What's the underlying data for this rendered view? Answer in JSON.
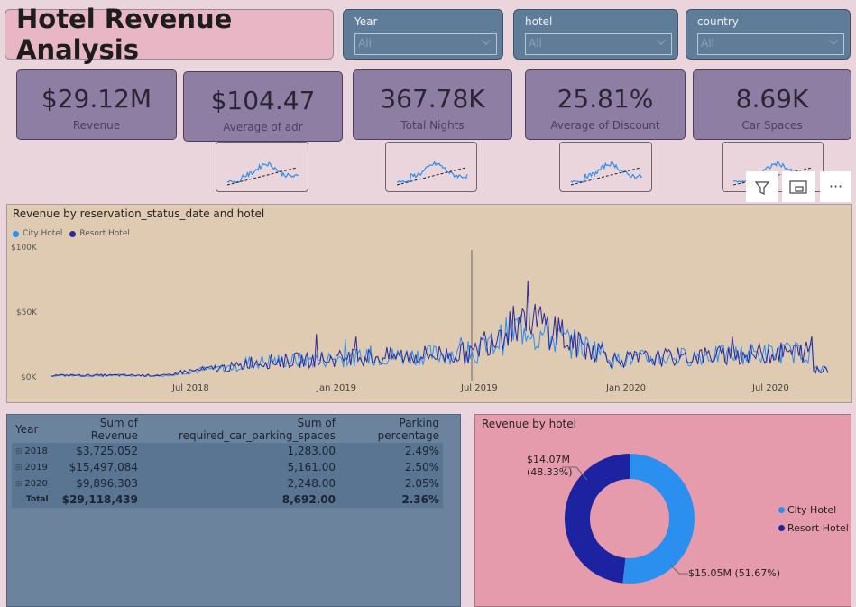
{
  "title": "Hotel Revenue Analysis",
  "slicers": [
    {
      "label": "Year",
      "value": "All"
    },
    {
      "label": "hotel",
      "value": "All"
    },
    {
      "label": "country",
      "value": "All"
    }
  ],
  "kpis": [
    {
      "value": "$29.12M",
      "caption": "Revenue"
    },
    {
      "value": "$104.47",
      "caption": "Average of adr"
    },
    {
      "value": "367.78K",
      "caption": "Total Nights"
    },
    {
      "value": "25.81%",
      "caption": "Average of Discount"
    },
    {
      "value": "8.69K",
      "caption": "Car Spaces"
    }
  ],
  "visual_toolbar": {
    "filter_icon": "filter-icon",
    "focus_icon": "focus-mode-icon",
    "more_label": "···"
  },
  "line_chart": {
    "title": "Revenue by reservation_status_date and hotel",
    "legend": [
      {
        "name": "City Hotel",
        "color": "#2b8ff0"
      },
      {
        "name": "Resort Hotel",
        "color": "#2c2a9a"
      }
    ],
    "y_ticks": [
      "$100K",
      "$50K",
      "$0K"
    ],
    "x_ticks": [
      "Jul 2018",
      "Jan 2019",
      "Jul 2019",
      "Jan 2020",
      "Jul 2020"
    ]
  },
  "table": {
    "headers": [
      "Year",
      "Sum of Revenue",
      "Sum of required_car_parking_spaces",
      "Parking percentage"
    ],
    "rows": [
      {
        "year": "2018",
        "revenue": "$3,725,052",
        "parking": "1,283.00",
        "pct": "2.49%"
      },
      {
        "year": "2019",
        "revenue": "$15,497,084",
        "parking": "5,161.00",
        "pct": "2.50%"
      },
      {
        "year": "2020",
        "revenue": "$9,896,303",
        "parking": "2,248.00",
        "pct": "2.05%"
      }
    ],
    "total": {
      "label": "Total",
      "revenue": "$29,118,439",
      "parking": "8,692.00",
      "pct": "2.36%"
    }
  },
  "chart_data": {
    "type": "pie",
    "title": "Revenue by hotel",
    "slices": [
      {
        "name": "City Hotel",
        "value": 15.05,
        "label": "$15.05M (51.67%)",
        "color": "#2b8ff0"
      },
      {
        "name": "Resort Hotel",
        "value": 14.07,
        "label": "$14.07M",
        "percent_label": "(48.33%)",
        "color": "#1d22a0"
      }
    ],
    "legend": [
      "City Hotel",
      "Resort Hotel"
    ]
  }
}
